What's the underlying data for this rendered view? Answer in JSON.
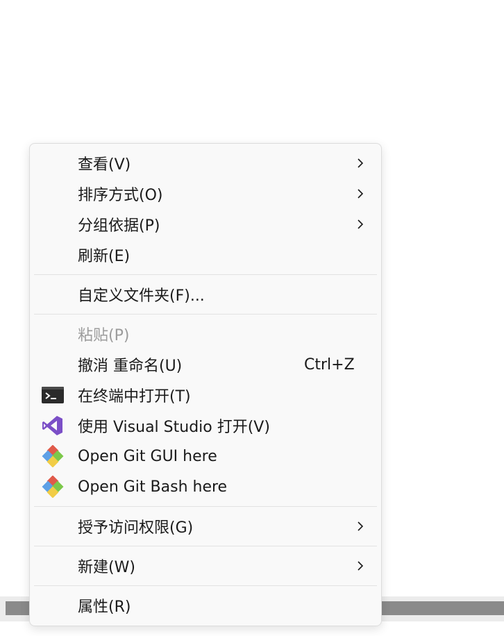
{
  "menu": {
    "items": [
      {
        "label": "查看(V)",
        "submenu": true
      },
      {
        "label": "排序方式(O)",
        "submenu": true
      },
      {
        "label": "分组依据(P)",
        "submenu": true
      },
      {
        "label": "刷新(E)"
      },
      {
        "label": "自定义文件夹(F)..."
      },
      {
        "label": "粘贴(P)",
        "disabled": true
      },
      {
        "label": "撤消 重命名(U)",
        "shortcut": "Ctrl+Z"
      },
      {
        "label": "在终端中打开(T)",
        "icon": "terminal-icon"
      },
      {
        "label": "使用 Visual Studio 打开(V)",
        "icon": "visual-studio-icon"
      },
      {
        "label": "Open Git GUI here",
        "icon": "git-icon"
      },
      {
        "label": "Open Git Bash here",
        "icon": "git-icon"
      },
      {
        "label": "授予访问权限(G)",
        "submenu": true
      },
      {
        "label": "新建(W)",
        "submenu": true
      },
      {
        "label": "属性(R)"
      }
    ]
  },
  "colors": {
    "menu_bg": "#f9f9f9",
    "text": "#1a1a1a",
    "disabled_text": "#9c9c9c",
    "vs_purple": "#7b4fc7"
  }
}
